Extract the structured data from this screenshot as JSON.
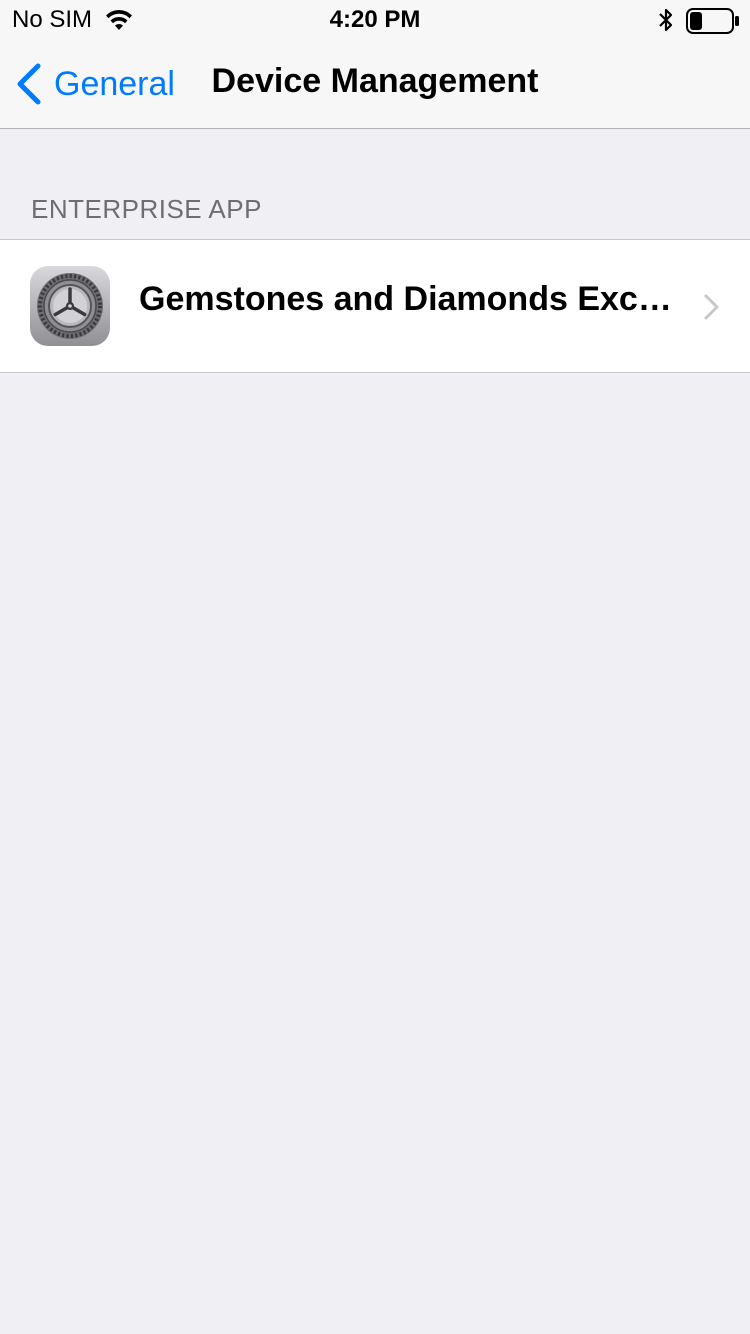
{
  "status_bar": {
    "carrier": "No SIM",
    "time": "4:20 PM",
    "icons": [
      "wifi-icon",
      "bluetooth-icon",
      "battery-icon"
    ],
    "battery_level": 0.3
  },
  "nav": {
    "back_label": "General",
    "title": "Device Management"
  },
  "section": {
    "header": "ENTERPRISE APP"
  },
  "apps": [
    {
      "name": "Gemstones and Diamonds Excha...",
      "icon": "settings-gear-icon"
    }
  ],
  "colors": {
    "accent": "#007aff",
    "background": "#efeff4",
    "section_header": "#6d6d72",
    "chevron": "#c7c7cc"
  }
}
